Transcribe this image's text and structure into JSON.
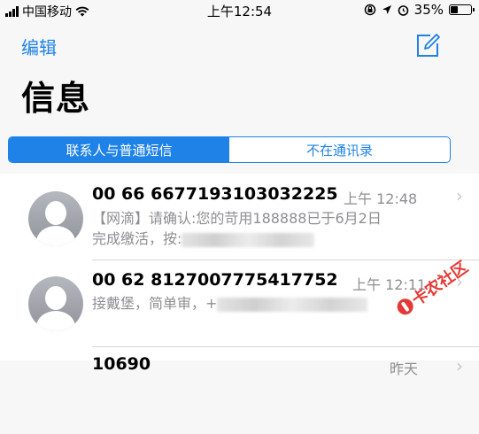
{
  "status_bar": {
    "carrier": "中国移动",
    "time": "上午12:54",
    "battery": "35%",
    "battery_level": 0.35,
    "icons": [
      "signal-icon",
      "wifi-icon",
      "rotation-lock-icon",
      "location-icon",
      "alarm-icon",
      "battery-icon"
    ]
  },
  "nav": {
    "edit_label": "编辑",
    "title": "信息",
    "compose_icon": "compose-icon"
  },
  "segmented": {
    "options": [
      "联系人与普通短信",
      "不在通讯录"
    ],
    "selected": "联系人与普通短信"
  },
  "messages": [
    {
      "sender": "00 66 6677193103032225",
      "time": "上午 12:48",
      "preview_line1": "【网滴】请确认:您的苛用188888已于6月2日",
      "preview_line2": "完成缴活，按:"
    },
    {
      "sender": "00 62 8127007775417752",
      "time": "上午 12:11",
      "preview_line1": "接戴堡，简单审，+"
    },
    {
      "sender": "10690",
      "time": "昨天"
    }
  ],
  "watermark": "卡农社区",
  "colors": {
    "accent": "#1e82e6",
    "secondary_text": "#8e8e93",
    "watermark": "#e53935"
  }
}
